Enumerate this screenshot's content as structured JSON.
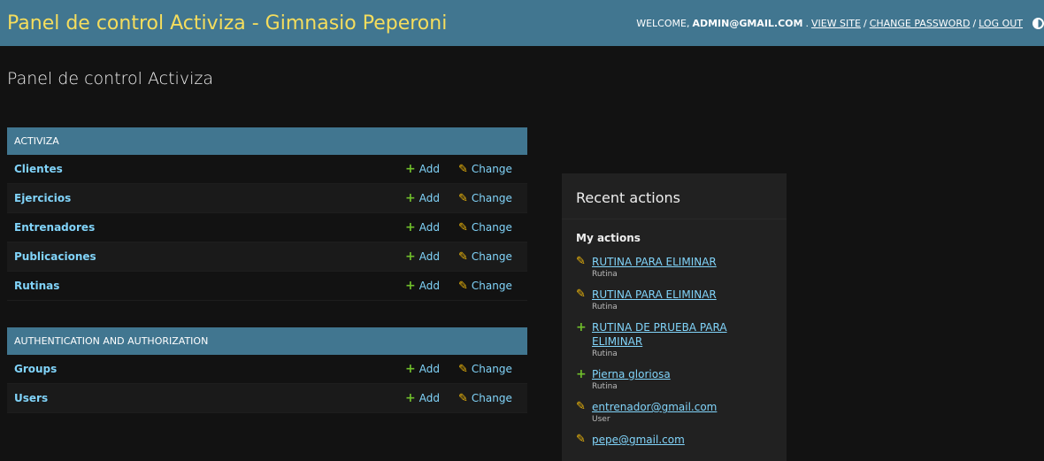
{
  "header": {
    "branding": "Panel de control Activiza - Gimnasio Peperoni",
    "welcome": "Welcome,",
    "username": "admin@gmail.com",
    "view_site": "View site",
    "change_password": "Change password",
    "log_out": "Log out",
    "separator": "/"
  },
  "page_title": "Panel de control Activiza",
  "modules": [
    {
      "caption": "Activiza",
      "models": [
        {
          "name": "Clientes",
          "add": "Add",
          "change": "Change"
        },
        {
          "name": "Ejercicios",
          "add": "Add",
          "change": "Change"
        },
        {
          "name": "Entrenadores",
          "add": "Add",
          "change": "Change"
        },
        {
          "name": "Publicaciones",
          "add": "Add",
          "change": "Change"
        },
        {
          "name": "Rutinas",
          "add": "Add",
          "change": "Change"
        }
      ]
    },
    {
      "caption": "Authentication and Authorization",
      "models": [
        {
          "name": "Groups",
          "add": "Add",
          "change": "Change"
        },
        {
          "name": "Users",
          "add": "Add",
          "change": "Change"
        }
      ]
    }
  ],
  "sidebar": {
    "title": "Recent actions",
    "subtitle": "My actions",
    "actions": [
      {
        "icon": "pencil-icon",
        "kind": "change",
        "title": "RUTINA PARA ELIMINAR",
        "type": "Rutina"
      },
      {
        "icon": "pencil-icon",
        "kind": "change",
        "title": "RUTINA PARA ELIMINAR",
        "type": "Rutina"
      },
      {
        "icon": "plus-icon",
        "kind": "add",
        "title": "RUTINA DE PRUEBA PARA ELIMINAR",
        "type": "Rutina"
      },
      {
        "icon": "plus-icon",
        "kind": "add",
        "title": "Pierna gloriosa",
        "type": "Rutina"
      },
      {
        "icon": "pencil-icon",
        "kind": "change",
        "title": "entrenador@gmail.com",
        "type": "User"
      },
      {
        "icon": "pencil-icon",
        "kind": "change",
        "title": "pepe@gmail.com",
        "type": ""
      }
    ]
  },
  "colors": {
    "header_bg": "#417690",
    "branding": "#f5dd5d",
    "link": "#81d4fa",
    "add_icon": "#70bf2b",
    "change_icon": "#efb80b",
    "page_bg": "#121212"
  }
}
